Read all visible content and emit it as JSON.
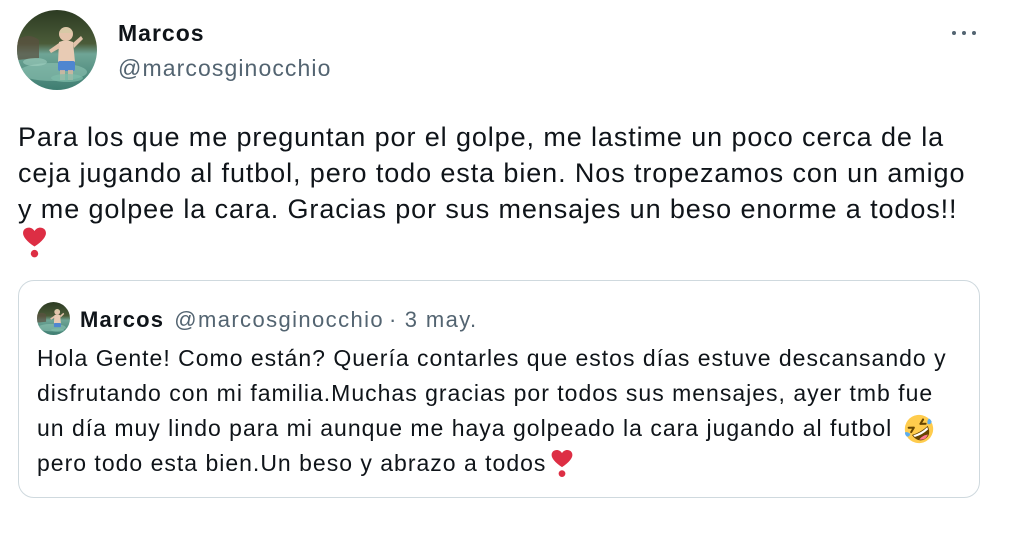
{
  "tweet": {
    "author": {
      "name": "Marcos",
      "handle": "@marcosginocchio"
    },
    "more_icon": "more-horizontal",
    "text_lines": [
      "Para los que me preguntan por el golpe, me lastime un poco cerca de la",
      "ceja jugando al futbol, pero todo esta bien. Nos tropezamos con un amigo",
      "y me golpee la cara. Gracias por sus mensajes un beso enorme a todos!!"
    ],
    "trailing_emoji_icon": "heart-exclamation",
    "quoted_tweet": {
      "author": {
        "name": "Marcos",
        "handle": "@marcosginocchio"
      },
      "separator": "·",
      "date": "3 may.",
      "lines": [
        {
          "text": "Hola Gente! Como están? Quería contarles que estos días estuve descansando y"
        },
        {
          "text": "disfrutando con mi familia.Muchas gracias por todos sus mensajes, ayer tmb fue"
        },
        {
          "text": "un día muy lindo para mi aunque me haya golpeado la cara jugando al futbol",
          "emoji_icon": "rolling-on-the-floor-laughing"
        },
        {
          "text": "pero todo esta bien.Un beso y abrazo a todos",
          "emoji_icon": "heart-exclamation"
        }
      ]
    }
  },
  "colors": {
    "text": "#0f1419",
    "secondary_text": "#536471",
    "card_border": "#cfd9de",
    "heart": "#dd2e44",
    "laughing_face": "#ffcc4d"
  }
}
